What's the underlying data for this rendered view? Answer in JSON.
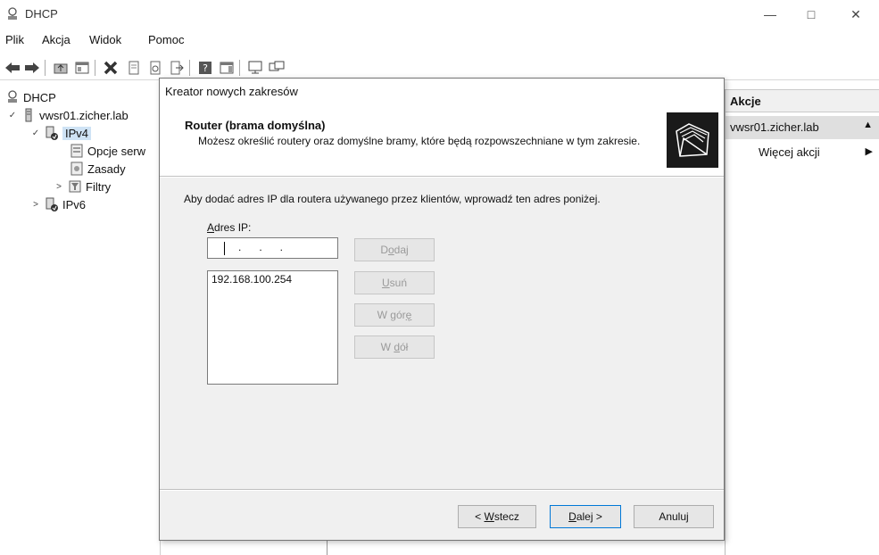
{
  "window": {
    "title": "DHCP",
    "controls": {
      "minimize": "—",
      "maximize": "□",
      "close": "✕"
    }
  },
  "menu": [
    "Plik",
    "Akcja",
    "Widok",
    "Pomoc"
  ],
  "tree": {
    "root": "DHCP",
    "server": "vwsr01.zicher.lab",
    "ipv4": "IPv4",
    "options": "Opcje serw",
    "policies": "Zasady",
    "filters": "Filtry",
    "ipv6": "IPv6"
  },
  "actions": {
    "header": "Akcje",
    "server": "vwsr01.zicher.lab",
    "more": "Więcej akcji"
  },
  "dialog": {
    "title": "Kreator nowych zakresów",
    "header_title": "Router (brama domyślna)",
    "header_desc": "Możesz określić routery oraz domyślne bramy, które będą rozpowszechniane w tym zakresie.",
    "instruction": "Aby dodać adres IP dla routera używanego przez klientów, wprowadź ten adres poniżej.",
    "ip_label_accel": "A",
    "ip_label_rest": "dres IP:",
    "ip_input_dots": ".      .      .",
    "routers": [
      "192.168.100.254"
    ],
    "buttons": {
      "add": {
        "pre": "D",
        "accel": "o",
        "post": "daj"
      },
      "remove": {
        "pre": "",
        "accel": "U",
        "post": "suń"
      },
      "up": {
        "pre": "W gór",
        "accel": "ę",
        "post": ""
      },
      "down": {
        "pre": "W ",
        "accel": "d",
        "post": "ół"
      },
      "back": {
        "pre": "< ",
        "accel": "W",
        "post": "stecz"
      },
      "next": {
        "pre": "",
        "accel": "D",
        "post": "alej >"
      },
      "cancel": "Anuluj"
    }
  }
}
